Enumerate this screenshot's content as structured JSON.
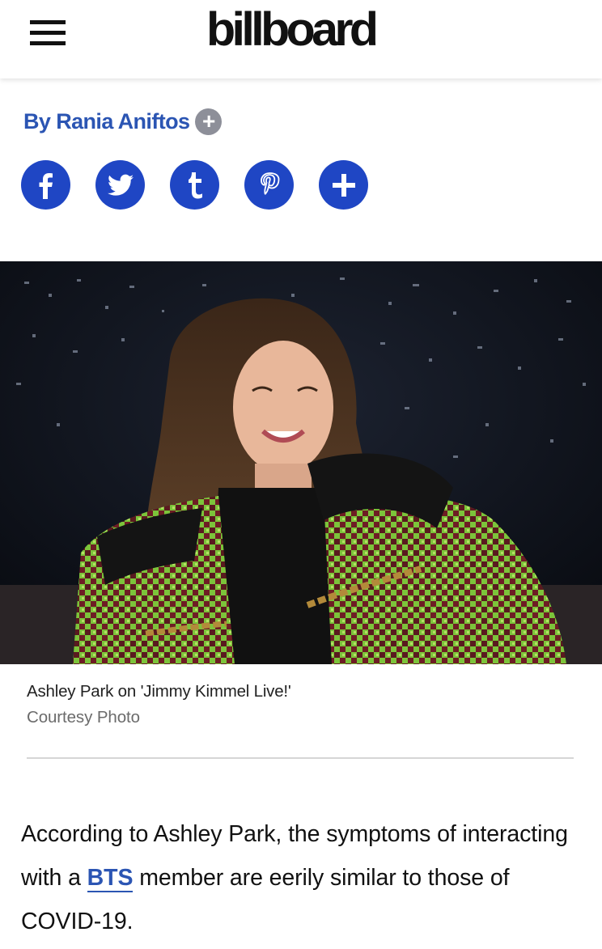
{
  "header": {
    "logo_text": "billboard",
    "menu_icon": "hamburger-menu-icon"
  },
  "byline": {
    "text": "By Rania Aniftos",
    "follow_icon": "plus-icon"
  },
  "share_buttons": [
    {
      "icon": "facebook-icon",
      "glyph": "f"
    },
    {
      "icon": "twitter-icon",
      "glyph": "bird"
    },
    {
      "icon": "tumblr-icon",
      "glyph": "t"
    },
    {
      "icon": "pinterest-icon",
      "glyph": "p"
    },
    {
      "icon": "more-share-icon",
      "glyph": "+"
    }
  ],
  "photo": {
    "alt": "Ashley Park on 'Jimmy Kimmel Live!'",
    "caption": "Ashley Park on 'Jimmy Kimmel Live!'",
    "credit": "Courtesy Photo"
  },
  "article": {
    "text_before_link": "According to Ashley Park, the symptoms of interacting with a ",
    "link_text": "BTS",
    "text_after_link": " member are eerily similar to those of COVID-19."
  },
  "colors": {
    "accent_blue": "#2b55b3",
    "share_blue": "#1f46c4",
    "follow_gray": "#8d8f99"
  }
}
